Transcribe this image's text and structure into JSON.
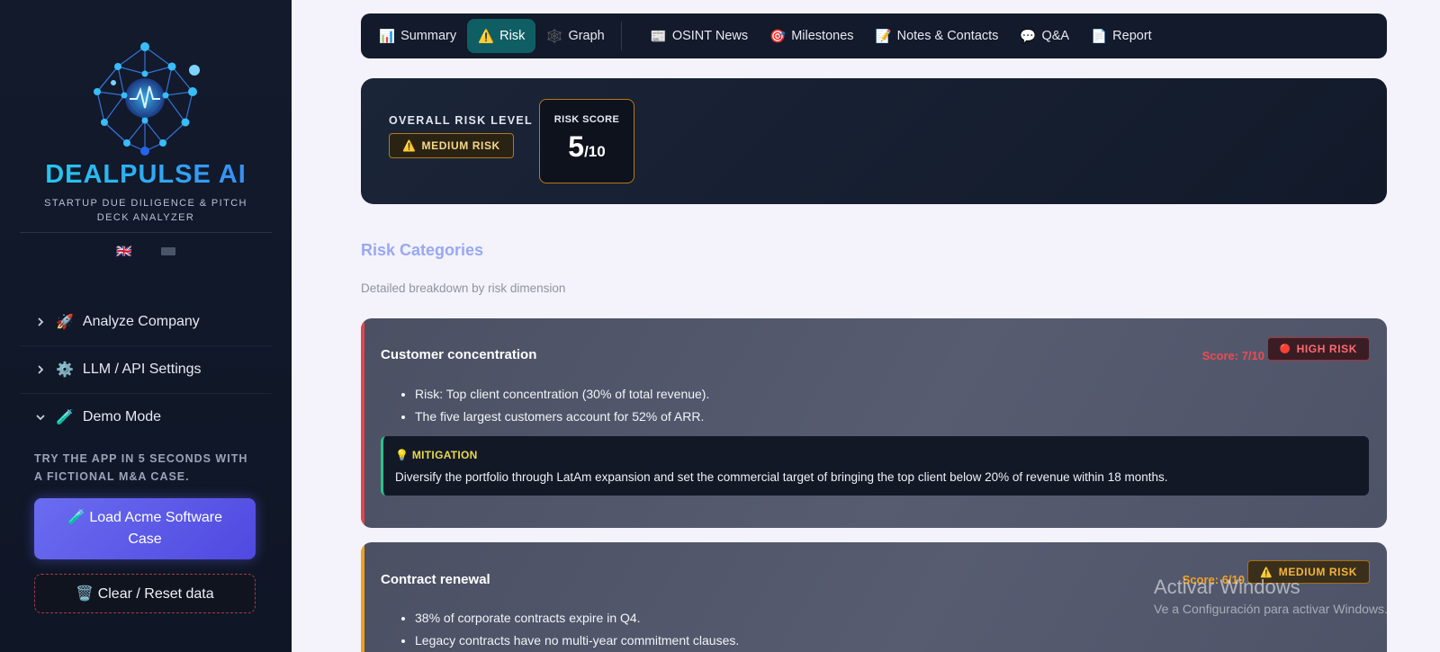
{
  "sidebar": {
    "brand": "DEALPULSE AI",
    "tagline": "STARTUP DUE DILIGENCE & PITCH DECK ANALYZER",
    "languages": [
      "🇬🇧"
    ],
    "nav": [
      {
        "icon": "🚀",
        "label": "Analyze Company",
        "expanded": false
      },
      {
        "icon": "⚙️",
        "label": "LLM / API Settings",
        "expanded": false
      },
      {
        "icon": "🧪",
        "label": "Demo Mode",
        "expanded": true
      }
    ],
    "demo_description": "TRY THE APP IN 5 SECONDS WITH A FICTIONAL M&A CASE.",
    "load_button": "🧪 Load Acme Software Case",
    "clear_button": "🗑️ Clear / Reset data"
  },
  "tabs": [
    {
      "icon": "📊",
      "label": "Summary"
    },
    {
      "icon": "⚠️",
      "label": "Risk",
      "active": true
    },
    {
      "icon": "🕸️",
      "label": "Graph"
    },
    {
      "icon": "📰",
      "label": "OSINT News"
    },
    {
      "icon": "🎯",
      "label": "Milestones"
    },
    {
      "icon": "📝",
      "label": "Notes & Contacts"
    },
    {
      "icon": "💬",
      "label": "Q&A"
    },
    {
      "icon": "📄",
      "label": "Report"
    }
  ],
  "risk_overview": {
    "label": "OVERALL RISK LEVEL",
    "badge": "MEDIUM RISK",
    "badge_icon": "⚠️",
    "score_label": "RISK SCORE",
    "score": "5",
    "score_max": "/10"
  },
  "section": {
    "title": "Risk Categories",
    "subtitle": "Detailed breakdown by risk dimension"
  },
  "categories": [
    {
      "title": "Customer concentration",
      "score": "Score: 7/10",
      "badge": "HIGH RISK",
      "badge_icon": "🔴",
      "color": "#e0474c",
      "bullets": [
        "Risk: Top client concentration (30% of total revenue).",
        "The five largest customers account for 52% of ARR."
      ],
      "mitigation_label": "💡 MITIGATION",
      "mitigation": "Diversify the portfolio through LatAm expansion and set the commercial target of bringing the top client below 20% of revenue within 18 months."
    },
    {
      "title": "Contract renewal",
      "score": "Score: 6/10",
      "badge": "MEDIUM RISK",
      "badge_icon": "⚠️",
      "color": "#f0a020",
      "bullets": [
        "38% of corporate contracts expire in Q4.",
        "Legacy contracts have no multi-year commitment clauses."
      ]
    }
  ],
  "watermark": {
    "title": "Activar Windows",
    "subtitle": "Ve a Configuración para activar Windows."
  }
}
